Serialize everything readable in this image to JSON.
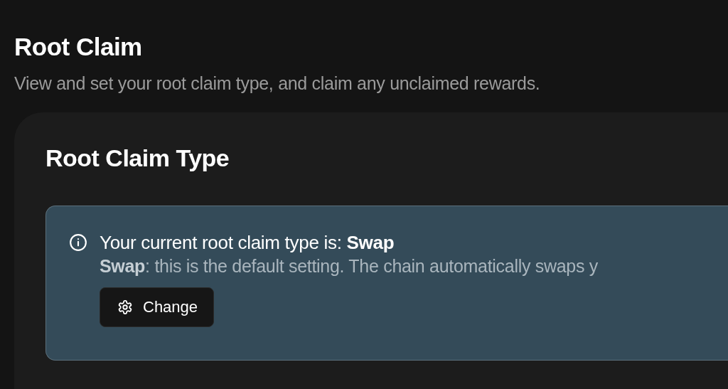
{
  "section": {
    "title": "Root Claim",
    "description": "View and set your root claim type, and claim any unclaimed rewards."
  },
  "card": {
    "title": "Root Claim Type",
    "notice": {
      "headline": "Your current root claim type is: **Swap**",
      "detail": "**Swap**: this is the default setting. The chain automatically swaps y",
      "button": "Change"
    }
  }
}
